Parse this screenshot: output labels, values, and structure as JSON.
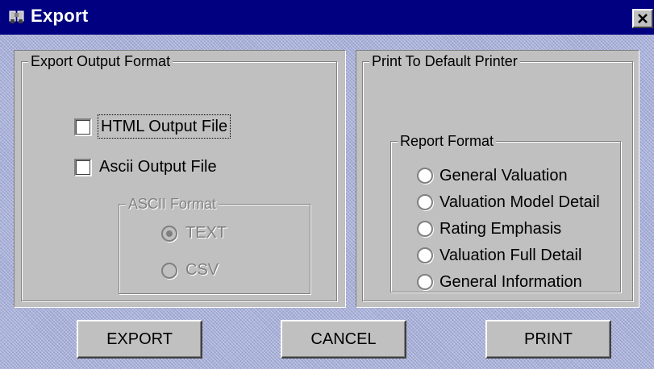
{
  "window": {
    "title": "Export"
  },
  "export_format": {
    "legend": "Export Output Format",
    "html_output": {
      "label": "HTML Output File",
      "checked": false
    },
    "ascii_output": {
      "label": "Ascii Output File",
      "checked": false
    },
    "ascii_format": {
      "legend": "ASCII  Format",
      "options": [
        "TEXT",
        "CSV"
      ],
      "selected": "TEXT",
      "enabled": false
    }
  },
  "print_panel": {
    "legend": "Print To Default Printer",
    "report_format": {
      "legend": "Report Format",
      "options": [
        "General Valuation",
        "Valuation Model Detail",
        "Rating Emphasis",
        "Valuation Full Detail",
        "General Information"
      ]
    }
  },
  "buttons": {
    "export": "EXPORT",
    "cancel": "CANCEL",
    "print": "PRINT"
  },
  "colors": {
    "titlebar": "#000080",
    "face": "#c0c0c0",
    "backdrop": "#a8b0d8"
  },
  "icons": {
    "app": "binoculars-icon",
    "close": "close-icon"
  }
}
